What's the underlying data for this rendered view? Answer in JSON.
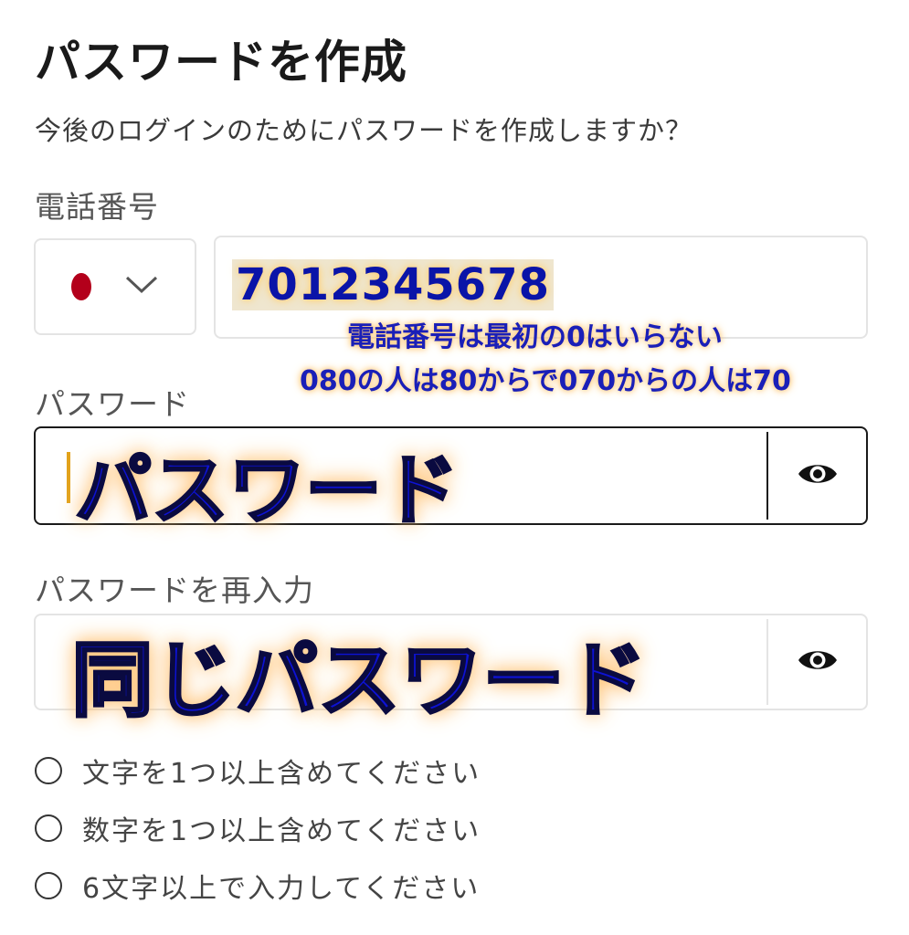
{
  "title": "パスワードを作成",
  "subtitle": "今後のログインのためにパスワードを作成しますか？",
  "phone": {
    "label": "電話番号",
    "value": "7012345678"
  },
  "annotations": {
    "note_line1": "電話番号は最初の0はいらない",
    "note_line2": "080の人は80からで070からの人は70",
    "password_overlay": "パスワード",
    "confirm_overlay": "同じパスワード"
  },
  "password": {
    "label": "パスワード"
  },
  "confirm": {
    "label": "パスワードを再入力"
  },
  "rules": [
    "文字を1つ以上含めてください",
    "数字を1つ以上含めてください",
    "6文字以上で入力してください"
  ],
  "colors": {
    "flag": "#b3001b",
    "annotation": "#0d12d4",
    "glow": "#ffb85c"
  },
  "icons": {
    "country_dropdown": "chevron-down-icon",
    "show_password": "eye-icon"
  }
}
